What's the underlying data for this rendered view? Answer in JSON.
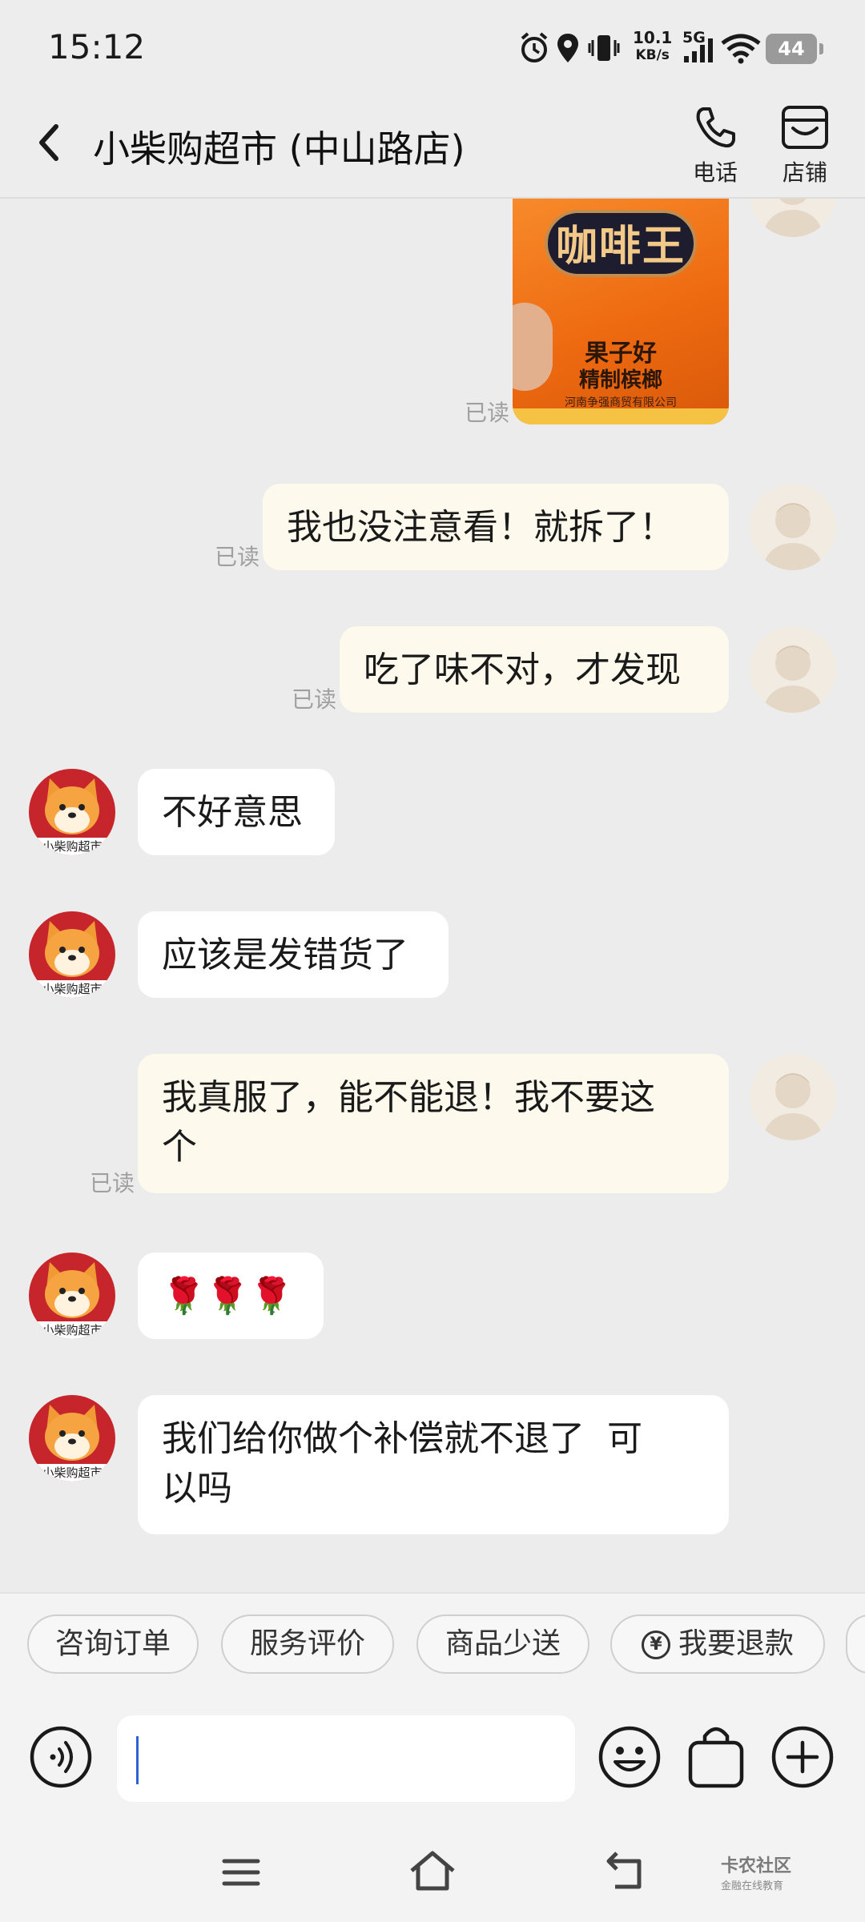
{
  "status_bar": {
    "time": "15:12",
    "net_speed_value": "10.1",
    "net_speed_unit": "KB/s",
    "network": "5G",
    "battery": "44",
    "icons": [
      "alarm-icon",
      "location-icon",
      "vibrate-icon",
      "signal-icon",
      "wifi-icon",
      "battery-icon"
    ]
  },
  "header": {
    "title": "小柴购超市 (中山路店)",
    "actions": [
      {
        "label": "电话",
        "icon": "phone-icon"
      },
      {
        "label": "店铺",
        "icon": "store-icon"
      }
    ]
  },
  "product_image": {
    "brand": "咖啡王",
    "line1": "果子好",
    "line2": "精制槟榔",
    "line3": "河南争强商贸有限公司"
  },
  "messages": [
    {
      "from": "me",
      "type": "image",
      "read": "已读"
    },
    {
      "from": "me",
      "text": "我也没注意看！就拆了！",
      "read": "已读"
    },
    {
      "from": "me",
      "text": "吃了味不对，才发现",
      "read": "已读"
    },
    {
      "from": "shop",
      "text": "不好意思",
      "avatar_label": "小柴购超市"
    },
    {
      "from": "shop",
      "text": "应该是发错货了",
      "avatar_label": "小柴购超市"
    },
    {
      "from": "me",
      "line1": "我真服了，能不能退！我不要这",
      "line2": "个",
      "read": "已读"
    },
    {
      "from": "shop",
      "text": "🌹🌹🌹",
      "avatar_label": "小柴购超市"
    },
    {
      "from": "shop",
      "line1": "我们给你做个补偿就不退了  可",
      "line2": "以吗",
      "avatar_label": "小柴购超市"
    }
  ],
  "quick_replies": [
    "咨询订单",
    "服务评价",
    "商品少送",
    "我要退款"
  ],
  "input": {
    "value": "",
    "placeholder": ""
  },
  "watermark": {
    "line1": "卡农社区",
    "line2": "金融在线教育"
  },
  "colors": {
    "bubble_out": "#fdf9ec",
    "bubble_in": "#ffffff",
    "background": "#ececec",
    "shop_avatar": "#c6262b"
  }
}
